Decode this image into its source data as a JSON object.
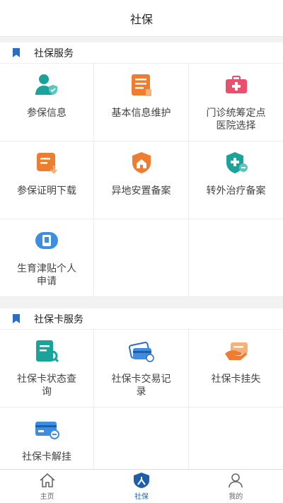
{
  "header": {
    "title": "社保"
  },
  "sections": [
    {
      "title": "社保服务"
    },
    {
      "title": "社保卡服务"
    }
  ],
  "social_security_items": [
    {
      "label": "参保信息",
      "icon": "user-shield-icon"
    },
    {
      "label": "基本信息维护",
      "icon": "document-list-icon"
    },
    {
      "label": "门诊统筹定点医院选择",
      "icon": "medical-kit-icon"
    },
    {
      "label": "参保证明下载",
      "icon": "download-doc-icon"
    },
    {
      "label": "异地安置备案",
      "icon": "home-shield-icon"
    },
    {
      "label": "转外治疗备案",
      "icon": "medical-shield-icon"
    },
    {
      "label": "生育津贴个人申请",
      "icon": "baby-card-icon"
    }
  ],
  "card_items": [
    {
      "label": "社保卡状态查询",
      "icon": "card-search-icon"
    },
    {
      "label": "社保卡交易记录",
      "icon": "card-transaction-icon"
    },
    {
      "label": "社保卡挂失",
      "icon": "card-lost-icon"
    },
    {
      "label": "社保卡解挂",
      "icon": "card-unlock-icon"
    }
  ],
  "tabbar": {
    "items": [
      {
        "label": "主页",
        "icon": "home-icon"
      },
      {
        "label": "社保",
        "icon": "person-badge-icon"
      },
      {
        "label": "我的",
        "icon": "profile-icon"
      }
    ]
  },
  "colors": {
    "accent": "#1f5eaa",
    "teal": "#1aa39a",
    "orange": "#ee7d2f",
    "pink": "#e8506e",
    "blue": "#3d8ee0"
  }
}
